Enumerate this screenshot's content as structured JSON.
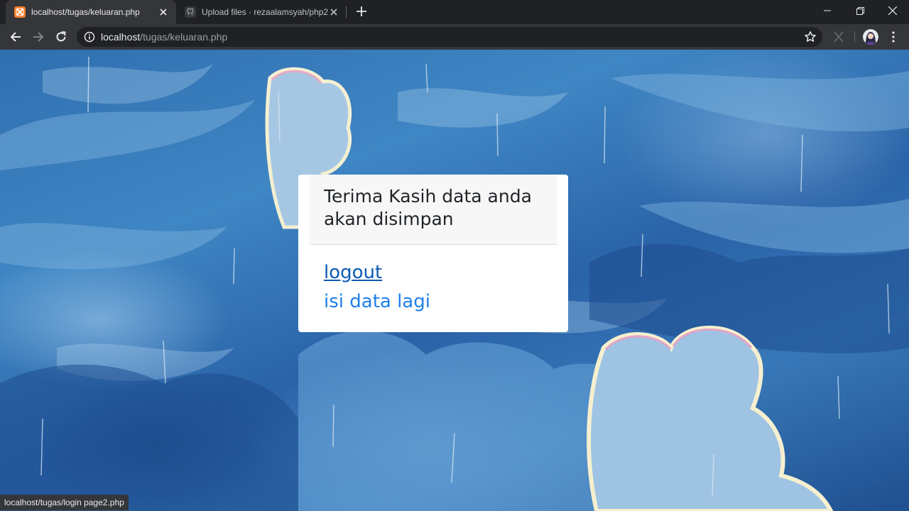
{
  "tabs": [
    {
      "title": "localhost/tugas/keluaran.php",
      "favicon": "xampp-icon",
      "active": true
    },
    {
      "title": "Upload files · rezaalamsyah/php2",
      "favicon": "github-icon",
      "active": false
    }
  ],
  "address_bar": {
    "host": "localhost",
    "path": "/tugas/keluaran.php"
  },
  "card": {
    "title_line1": "Terima Kasih data anda",
    "title_line2": "akan disimpan",
    "links": {
      "logout": "logout",
      "refill": "isi data lagi"
    }
  },
  "status_bar": {
    "url": "localhost/tugas/login page2.php"
  },
  "colors": {
    "link": "#1f80ec",
    "link_hover": "#0d5ab3",
    "chrome_dark": "#202124",
    "chrome_toolbar": "#35363a"
  }
}
